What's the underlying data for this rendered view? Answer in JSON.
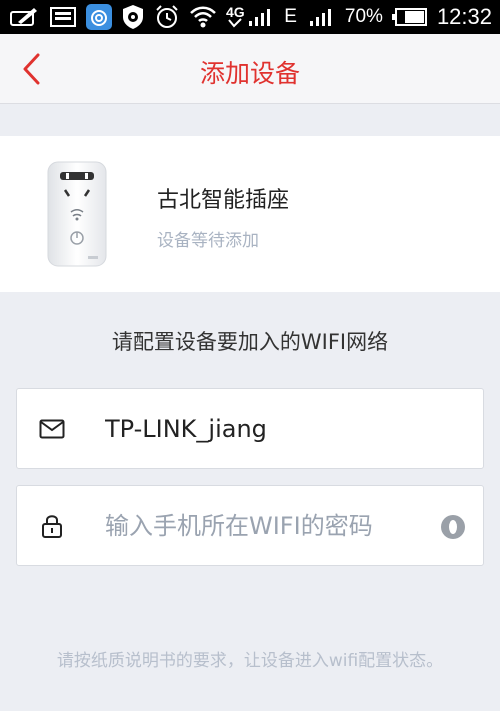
{
  "status_bar": {
    "icons": [
      "edit-icon",
      "gallery-icon",
      "cloud-app-icon",
      "shield-icon",
      "alarm-icon",
      "wifi-icon",
      "data-4g-icon",
      "signal-icon",
      "signal-e-icon",
      "signal-2-icon",
      "battery-icon"
    ],
    "network_4g": "4G",
    "network_e": "E",
    "battery_percent": "70%",
    "time": "12:32"
  },
  "header": {
    "title": "添加设备",
    "accent_color": "#e0322f"
  },
  "device": {
    "name": "古北智能插座",
    "status": "设备等待添加"
  },
  "wifi_section": {
    "label": "请配置设备要加入的WIFI网络",
    "ssid_value": "TP-LINK_jiang",
    "password_placeholder": "输入手机所在WIFI的密码"
  },
  "hint": {
    "text": "请按纸质说明书的要求，让设备进入wifi配置状态。"
  }
}
